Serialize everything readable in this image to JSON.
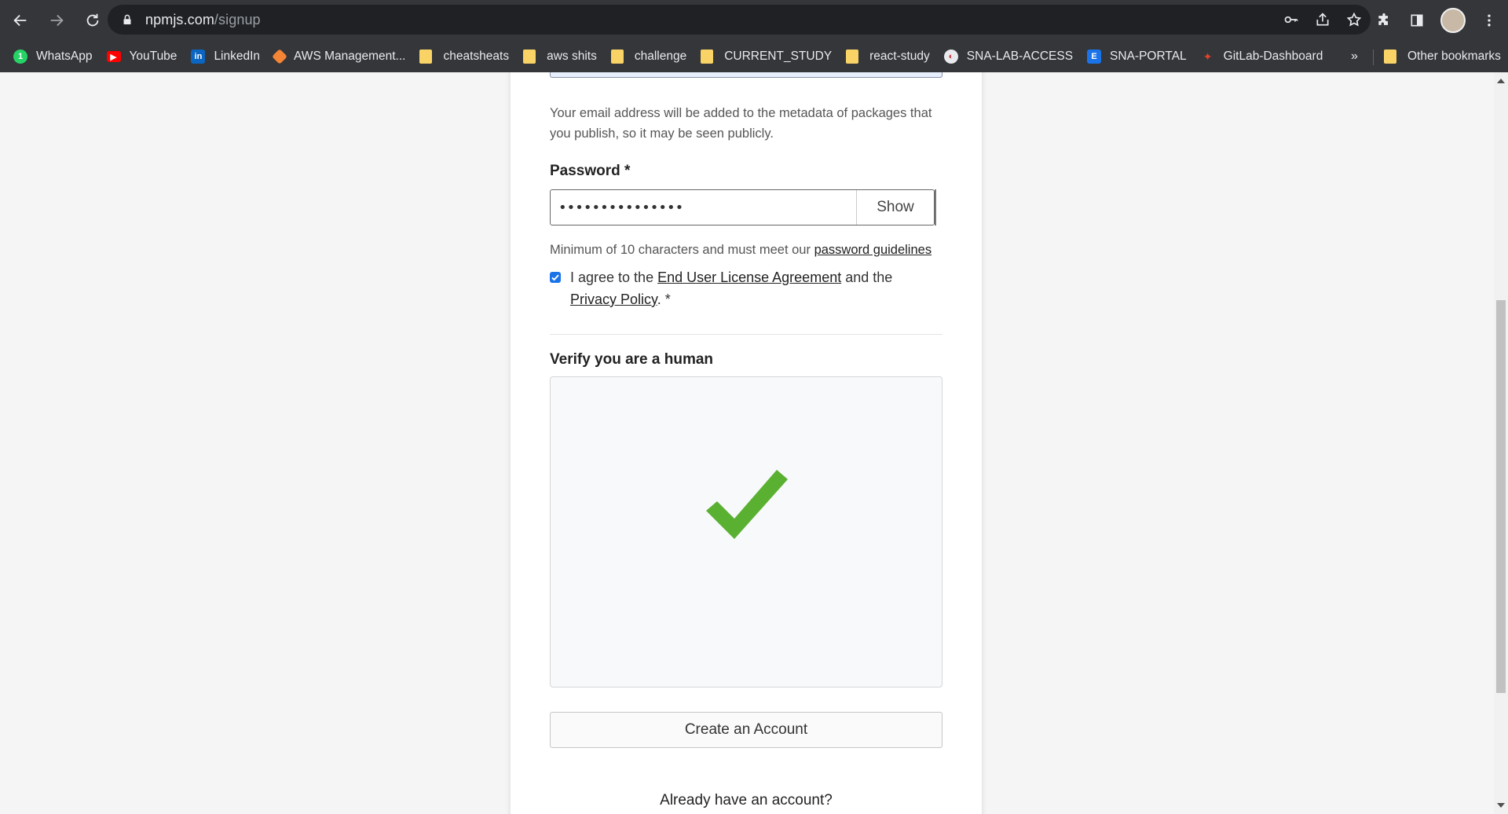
{
  "browser": {
    "url_host": "npmjs.com",
    "url_path": "/signup",
    "bookmarks": [
      {
        "label": "WhatsApp",
        "icon": "whatsapp-icon",
        "color": "#25d366"
      },
      {
        "label": "YouTube",
        "icon": "youtube-icon",
        "color": "#ff0000"
      },
      {
        "label": "LinkedIn",
        "icon": "linkedin-icon",
        "color": "#0a66c2"
      },
      {
        "label": "AWS Management...",
        "icon": "aws-icon",
        "color": "#f58536"
      },
      {
        "label": "cheatsheats",
        "icon": "folder-icon",
        "color": "#f9d366"
      },
      {
        "label": "aws shits",
        "icon": "folder-icon",
        "color": "#f9d366"
      },
      {
        "label": "challenge",
        "icon": "folder-icon",
        "color": "#f9d366"
      },
      {
        "label": "CURRENT_STUDY",
        "icon": "folder-icon",
        "color": "#f9d366"
      },
      {
        "label": "react-study",
        "icon": "folder-icon",
        "color": "#f9d366"
      },
      {
        "label": "SNA-LAB-ACCESS",
        "icon": "sna-lab-icon",
        "color": "#e8eaed"
      },
      {
        "label": "SNA-PORTAL",
        "icon": "sna-portal-icon",
        "color": "#1a73e8"
      },
      {
        "label": "GitLab-Dashboard",
        "icon": "gitlab-icon",
        "color": "#e24329"
      }
    ],
    "more_label": "»",
    "other_bookmarks": "Other bookmarks"
  },
  "form": {
    "email_help": "Your email address will be added to the metadata of packages that you publish, so it may be seen publicly.",
    "password_label": "Password *",
    "password_value": "•••••••••••••••",
    "show_label": "Show",
    "password_help_prefix": "Minimum of 10 characters and must meet our ",
    "password_help_link": "password guidelines",
    "agree_prefix": "I agree to the ",
    "eula_link": "End User License Agreement",
    "agree_middle": " and the ",
    "privacy_link": "Privacy Policy",
    "agree_suffix": ". *",
    "agree_checked": true,
    "verify_label": "Verify you are a human",
    "captcha_status": "verified",
    "captcha_color": "#5ab031",
    "create_button": "Create an Account",
    "already_text": "Already have an account?"
  }
}
